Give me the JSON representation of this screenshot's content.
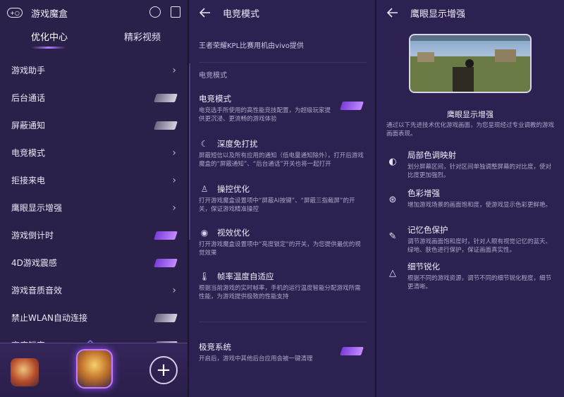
{
  "left_panel": {
    "title": "游戏魔盒",
    "tabs": [
      "优化中心",
      "精彩视频"
    ],
    "rows": [
      {
        "label": "游戏助手",
        "control": "chevron"
      },
      {
        "label": "后台通话",
        "control": "toggle",
        "on": false
      },
      {
        "label": "屏蔽通知",
        "control": "toggle",
        "on": false
      },
      {
        "label": "电竞模式",
        "control": "chevron"
      },
      {
        "label": "拒接来电",
        "control": "chevron"
      },
      {
        "label": "鹰眼显示增强",
        "control": "chevron"
      },
      {
        "label": "游戏倒计时",
        "control": "toggle",
        "on": true
      },
      {
        "label": "4D游戏震感",
        "control": "toggle",
        "on": true
      },
      {
        "label": "游戏音质音效",
        "control": "chevron"
      },
      {
        "label": "禁止WLAN自动连接",
        "control": "toggle",
        "on": false
      },
      {
        "label": "亮度锁定",
        "control": "toggle",
        "on": false
      }
    ],
    "dock": {
      "add_symbol": "+"
    }
  },
  "middle_panel": {
    "title": "电竞模式",
    "subtitle": "王者荣耀KPL比赛用机由vivo提供",
    "section": "电竞模式",
    "esports": {
      "title": "电竞模式",
      "desc": "电竞选手所使用的高性能竞技配置，为超级玩家提供更沉浸、更流畅的游戏体验",
      "on": true
    },
    "items": [
      {
        "icon": "no-disturb-icon",
        "title": "深度免打扰",
        "desc": "屏蔽短信以及所有应用的通知（低电量通知除外），打开后游戏魔盒的“屏蔽通知”、“后台通话”开关也将一起打开"
      },
      {
        "icon": "joystick-icon",
        "title": "操控优化",
        "desc": "打开游戏魔盒设置项中“屏蔽AI按键”、“屏蔽三指截屏”的开关，保证游戏精准操控"
      },
      {
        "icon": "eye-icon",
        "title": "视效优化",
        "desc": "打开游戏魔盒设置项中“亮度锁定”的开关，为您提供最优的视觉效果"
      },
      {
        "icon": "thermometer-icon",
        "title": "帧率温度自适应",
        "desc": "根据当前游戏的实时帧率，手机的运行温度智能分配游戏所需性能，为游戏提供极致的性能支持"
      }
    ],
    "extreme": {
      "title": "极竞系统",
      "desc": "开启后，游戏中其他后台应用会被一键清理",
      "on": true
    }
  },
  "right_panel": {
    "title": "鹰眼显示增强",
    "caption": "鹰眼显示增强",
    "desc": "通过以下先进技术优化游戏画面，为您呈现经过专业调教的游戏画面表现。",
    "features": [
      {
        "icon": "contrast-icon",
        "title": "局部色调映射",
        "desc": "划分屏幕区间，针对区间单独调整屏幕的对比度，使对比度更加强烈。"
      },
      {
        "icon": "color-circles-icon",
        "title": "色彩增强",
        "desc": "增加游戏场景的画面饱和度，使游戏显示色彩更鲜艳。"
      },
      {
        "icon": "color-memory-icon",
        "title": "记忆色保护",
        "desc": "调节游戏画面饱和度时，针对人眼有视觉记忆的蓝天、绿地、肤色进行保护，保证画面真实性。"
      },
      {
        "icon": "sharpen-icon",
        "title": "细节锐化",
        "desc": "根据不同的游戏资源，调节不同的细节锐化程度，细节更清晰。"
      }
    ]
  },
  "colors": {
    "accent": "#b27bff",
    "bg": "#2b2049"
  }
}
